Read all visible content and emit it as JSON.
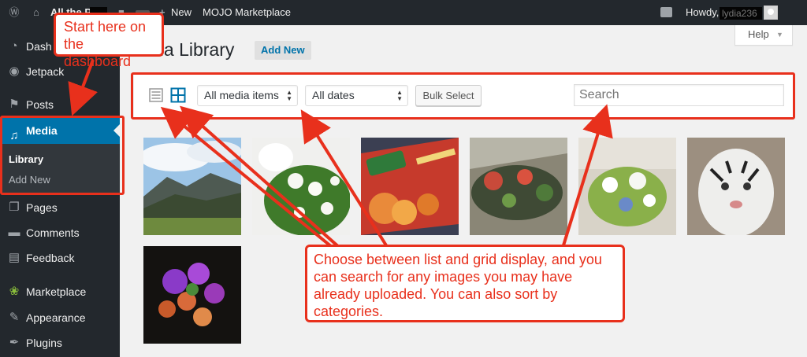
{
  "admin_bar": {
    "site_name": "All the P",
    "new_label": "New",
    "marketplace_label": "MOJO Marketplace",
    "howdy": "Howdy,",
    "username": "lydia236"
  },
  "sidebar": {
    "items": [
      {
        "label": "Dash",
        "icon": "dashboard-icon"
      },
      {
        "label": "Jetpack",
        "icon": "jetpack-icon"
      },
      {
        "label": "Posts",
        "icon": "pushpin-icon"
      },
      {
        "label": "Media",
        "icon": "media-icon"
      },
      {
        "label": "Pages",
        "icon": "pages-icon"
      },
      {
        "label": "Comments",
        "icon": "comments-icon"
      },
      {
        "label": "Feedback",
        "icon": "feedback-icon"
      },
      {
        "label": "Marketplace",
        "icon": "marketplace-icon"
      },
      {
        "label": "Appearance",
        "icon": "appearance-icon"
      },
      {
        "label": "Plugins",
        "icon": "plugins-icon"
      }
    ],
    "media_submenu": [
      {
        "label": "Library"
      },
      {
        "label": "Add New"
      }
    ]
  },
  "main": {
    "title": "dia Library",
    "add_new_label": "Add New",
    "help_label": "Help",
    "filter_type": "All media items",
    "filter_date": "All dates",
    "bulk_select_label": "Bulk Select",
    "search_placeholder": "Search"
  },
  "annotations": {
    "dashboard_note": "Start here on the dashboard",
    "main_note": "Choose between list and grid display, and you can search for any images you may have already uploaded. You can also sort by categories."
  },
  "colors": {
    "adminbar_bg": "#23282d",
    "accent": "#0073aa",
    "annotation_red": "#e8301c"
  }
}
